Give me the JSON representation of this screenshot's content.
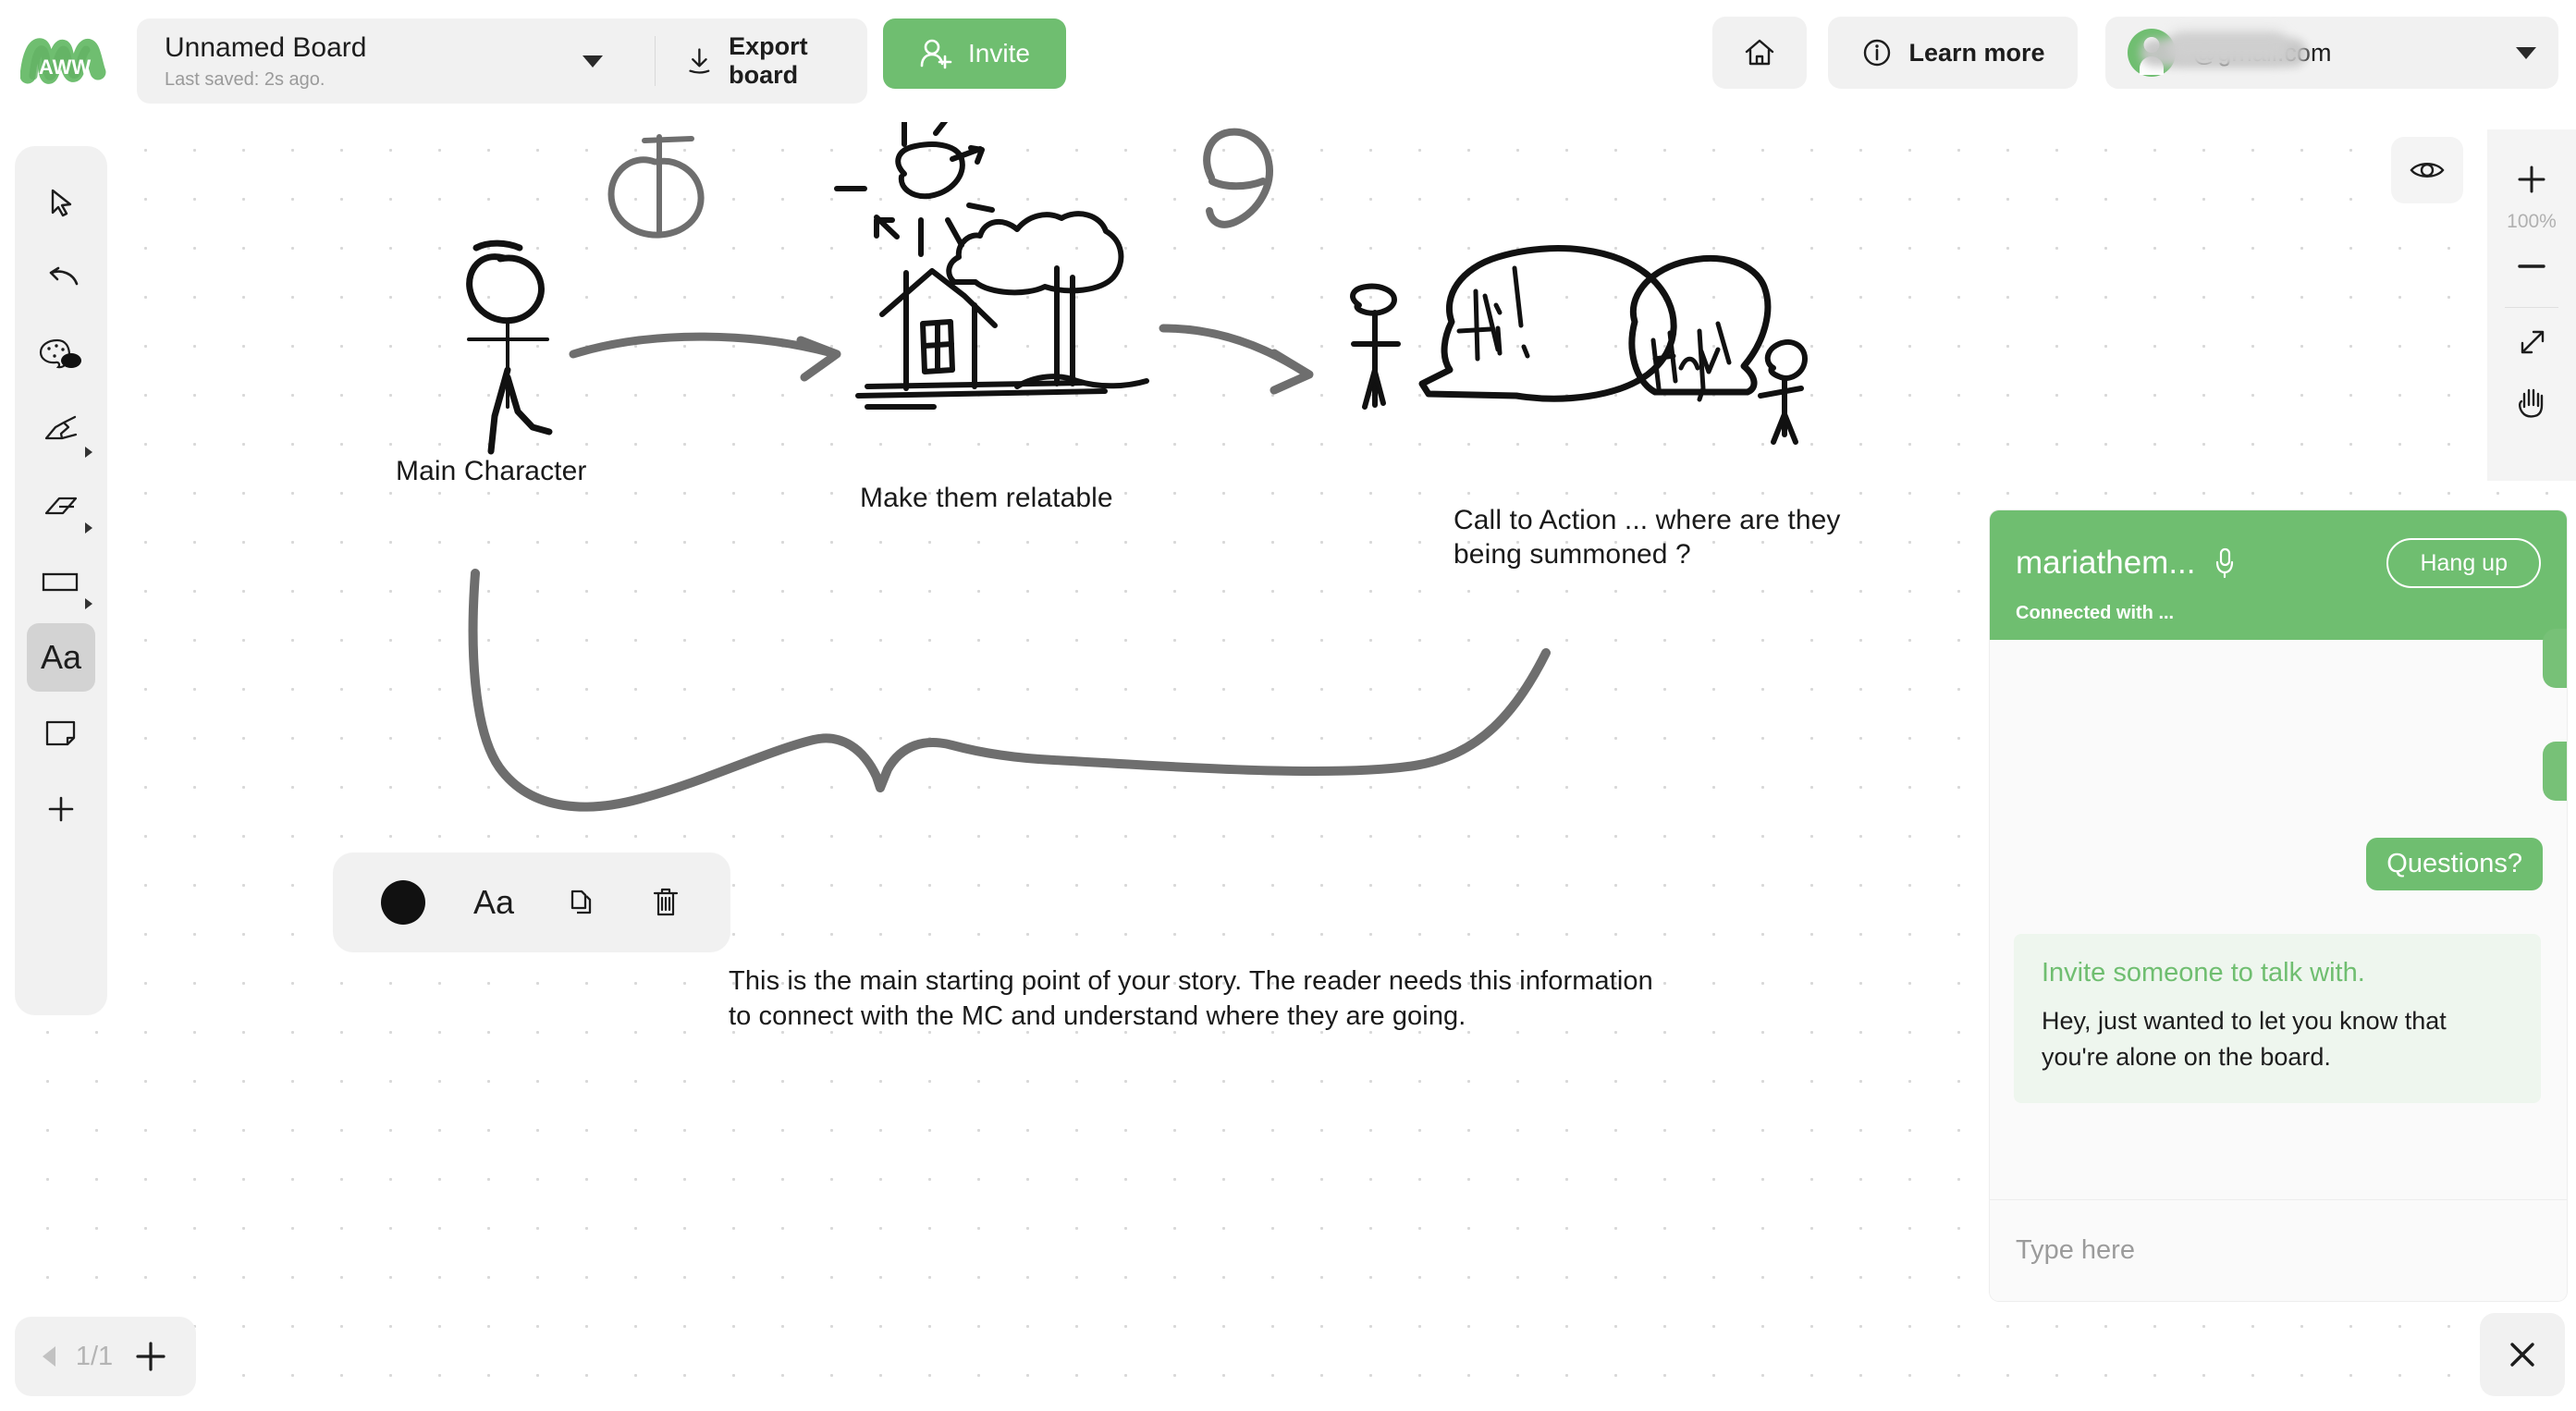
{
  "app": {
    "logo_text": "AWW",
    "accent_green": "#6fbe70",
    "ink_black": "#111111",
    "ink_gray": "#6e6e6e"
  },
  "topbar": {
    "board_title": "Unnamed Board",
    "board_saved": "Last saved: 2s ago.",
    "board_dropdown_icon": "chevron-down-icon",
    "export_label": "Export board",
    "export_icon": "download-icon",
    "invite_label": "Invite",
    "invite_icon": "user-plus-icon",
    "home_icon": "home-icon",
    "learn_more_label": "Learn more",
    "learn_more_icon": "info-circle-icon",
    "account_email": "@gmail.com",
    "account_avatar": "user-avatar-icon",
    "account_dropdown_icon": "chevron-down-icon"
  },
  "toolbar": {
    "items": [
      {
        "name": "select-tool",
        "icon": "cursor-arrow-icon",
        "active": false,
        "has_submenu": false
      },
      {
        "name": "undo-tool",
        "icon": "undo-arrow-icon",
        "active": false,
        "has_submenu": false
      },
      {
        "name": "color-tool",
        "icon": "palette-icon",
        "active": false,
        "has_submenu": false
      },
      {
        "name": "pen-tool",
        "icon": "marker-pen-icon",
        "active": false,
        "has_submenu": true
      },
      {
        "name": "eraser-tool",
        "icon": "eraser-icon",
        "active": false,
        "has_submenu": true
      },
      {
        "name": "shape-tool",
        "icon": "rectangle-icon",
        "active": false,
        "has_submenu": true
      },
      {
        "name": "text-tool",
        "icon": "text-aa-icon",
        "label": "Aa",
        "active": true,
        "has_submenu": false
      },
      {
        "name": "sticky-note-tool",
        "icon": "sticky-note-icon",
        "active": false,
        "has_submenu": false
      },
      {
        "name": "add-more-tool",
        "icon": "plus-icon",
        "active": false,
        "has_submenu": false
      }
    ]
  },
  "context_toolbar": {
    "color_swatch": "#111111",
    "color_icon": "color-circle-icon",
    "font_label": "Aa",
    "font_icon": "text-aa-icon",
    "duplicate_icon": "copy-icon",
    "delete_icon": "trash-icon"
  },
  "zoom_controls": {
    "visibility_icon": "eye-icon",
    "zoom_in_icon": "plus-icon",
    "zoom_level": "100%",
    "zoom_out_icon": "minus-icon",
    "fit_screen_icon": "expand-diagonal-icon",
    "pan_icon": "hand-icon"
  },
  "canvas": {
    "notes": [
      {
        "id": "main-character",
        "text": "Main Character"
      },
      {
        "id": "relatable",
        "text": "Make them relatable"
      },
      {
        "id": "cta",
        "text": "Call to Action ... where are they\nbeing summoned ?"
      },
      {
        "id": "paragraph",
        "text": "This is the main starting point of your story. The reader needs this information\nto connect with the MC and understand where they are going."
      }
    ],
    "sketch_labels": {
      "speech_bubble_1": "Hi!",
      "speech_bubble_2": "Hey"
    }
  },
  "chat": {
    "caller_name": "mariathem...",
    "mic_icon": "microphone-icon",
    "hangup_label": "Hang up",
    "connected_status": "Connected with ...",
    "edge_bubbles": [
      ",",
      ","
    ],
    "sent_message": "Questions?",
    "system_title": "Invite someone to talk with.",
    "system_body": "Hey, just wanted to let you know that you're alone on the board.",
    "input_placeholder": "Type here",
    "input_value": ""
  },
  "page_nav": {
    "prev_icon": "triangle-left-icon",
    "indicator": "1/1",
    "add_icon": "plus-icon"
  },
  "close_button": {
    "icon": "close-x-icon"
  }
}
